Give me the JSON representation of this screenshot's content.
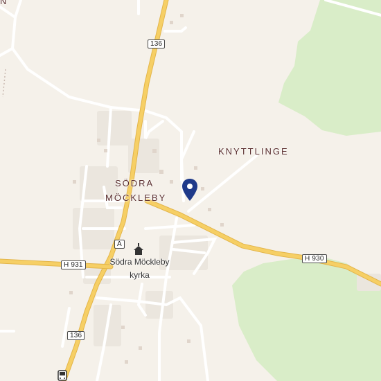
{
  "map": {
    "places": {
      "village": [
        "SÖDRA",
        "MÖCKLEBY"
      ],
      "hamlet": "KNYTTLINGE",
      "edge_fragment": "N"
    },
    "roads": {
      "route_136_top": "136",
      "route_136_bottom": "136",
      "h931": "H 931",
      "h930": "H 930",
      "marker_a": "A"
    },
    "poi": {
      "church_name": "Södra Möckleby",
      "church_suffix": "kyrka"
    },
    "pin_color": "#1f3a8a",
    "colors": {
      "land": "#f5f1ea",
      "forest": "#d9edc8",
      "primary_road": "#f6cf65",
      "road_casing": "#e3b54a",
      "minor_road": "#ffffff"
    }
  }
}
